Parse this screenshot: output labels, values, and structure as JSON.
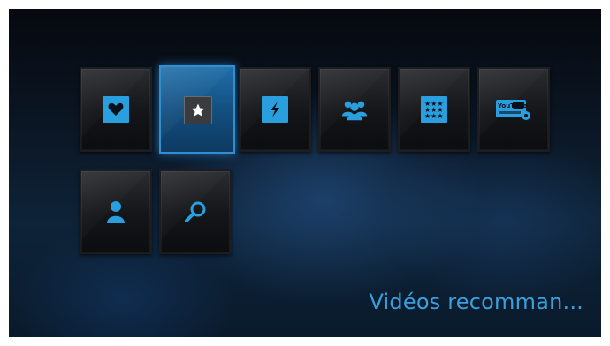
{
  "menu": {
    "tiles": [
      {
        "icon": "heart-icon"
      },
      {
        "icon": "star-icon",
        "selected": true
      },
      {
        "icon": "lightning-icon"
      },
      {
        "icon": "people-icon"
      },
      {
        "icon": "rating-stars-icon"
      },
      {
        "icon": "youtube-settings-icon"
      },
      {
        "icon": "person-icon"
      },
      {
        "icon": "search-icon"
      }
    ],
    "selected_label": "Vidéos recomman...",
    "youtube_logo_text": "YouTube"
  },
  "colors": {
    "accent": "#2a9fe0",
    "label": "#3aa0dc",
    "selected_border": "#2f8fd0"
  }
}
